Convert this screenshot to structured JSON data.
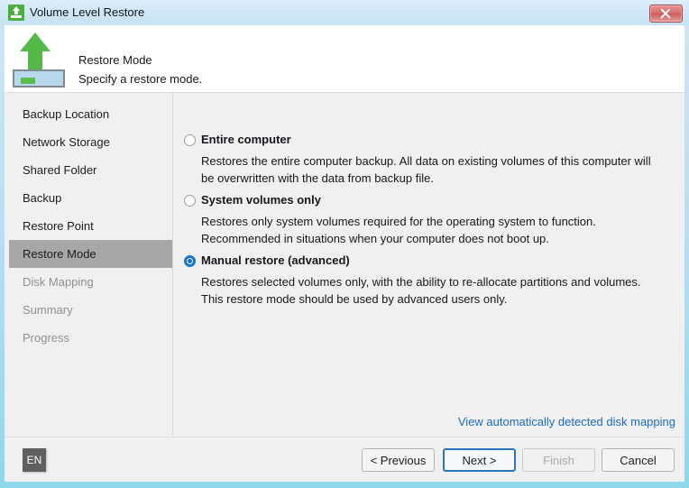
{
  "window": {
    "title": "Volume Level Restore",
    "close_label": "Close",
    "icon": "restore-drive-icon"
  },
  "header": {
    "icon": "green-up-arrow-drive-icon",
    "title": "Restore Mode",
    "subtitle": "Specify a restore mode."
  },
  "sidebar": {
    "items": [
      {
        "label": "Backup Location",
        "state": "enabled"
      },
      {
        "label": "Network Storage",
        "state": "enabled"
      },
      {
        "label": "Shared Folder",
        "state": "enabled"
      },
      {
        "label": "Backup",
        "state": "enabled"
      },
      {
        "label": "Restore Point",
        "state": "enabled"
      },
      {
        "label": "Restore Mode",
        "state": "selected"
      },
      {
        "label": "Disk Mapping",
        "state": "disabled"
      },
      {
        "label": "Summary",
        "state": "disabled"
      },
      {
        "label": "Progress",
        "state": "disabled"
      }
    ]
  },
  "main": {
    "options": [
      {
        "label": "Entire computer",
        "description": "Restores the entire computer backup. All data on existing volumes of this computer will be overwritten with the data from backup file.",
        "selected": false
      },
      {
        "label": "System volumes only",
        "description": "Restores only system volumes required for the operating system to function. Recommended in situations when your computer does not boot up.",
        "selected": false
      },
      {
        "label": "Manual restore (advanced)",
        "description": "Restores selected volumes only, with the ability to re-allocate partitions and volumes. This restore mode should be used by advanced users only.",
        "selected": true
      }
    ],
    "link": "View automatically detected disk mapping"
  },
  "footer": {
    "language_badge": "EN",
    "buttons": {
      "previous": "< Previous",
      "next": "Next >",
      "finish": "Finish",
      "cancel": "Cancel"
    }
  },
  "colors": {
    "accent_blue": "#1271c4",
    "link_blue": "#1b6ec2",
    "icon_green": "#55b948",
    "selection_gray": "#a7a7a7",
    "close_red": "#c95c5c"
  }
}
